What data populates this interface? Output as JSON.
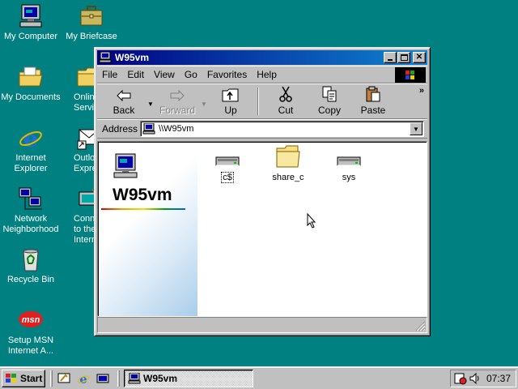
{
  "desktop": {
    "icons": [
      {
        "label": "My Computer",
        "icon": "my-computer-icon"
      },
      {
        "label": "My Briefcase",
        "icon": "briefcase-icon"
      },
      {
        "label": "My Documents",
        "icon": "my-documents-icon"
      },
      {
        "label": "Online Services",
        "icon": "online-services-folder-icon"
      },
      {
        "label": "Internet Explorer",
        "icon": "internet-explorer-icon"
      },
      {
        "label": "Outlook Express",
        "icon": "outlook-express-icon"
      },
      {
        "label": "Network Neighborhood",
        "icon": "network-neighborhood-icon"
      },
      {
        "label": "Connect to the Internet",
        "icon": "connect-internet-icon"
      },
      {
        "label": "Recycle Bin",
        "icon": "recycle-bin-icon"
      },
      {
        "label": "Setup MSN Internet A...",
        "icon": "msn-icon"
      }
    ],
    "background_color": "#008080"
  },
  "window": {
    "title": "W95vm",
    "menu": [
      "File",
      "Edit",
      "View",
      "Go",
      "Favorites",
      "Help"
    ],
    "toolbar": {
      "back": "Back",
      "forward": "Forward",
      "up": "Up",
      "cut": "Cut",
      "copy": "Copy",
      "paste": "Paste"
    },
    "address": {
      "label": "Address",
      "value": "\\\\W95vm"
    },
    "panel_title": "W95vm",
    "items": [
      {
        "label": "c$",
        "icon": "network-drive-icon",
        "selected": true
      },
      {
        "label": "share_c",
        "icon": "shared-folder-icon",
        "selected": false
      },
      {
        "label": "sys",
        "icon": "network-drive-icon",
        "selected": false
      }
    ],
    "title_bar_colors": [
      "#000080",
      "#1084d0"
    ]
  },
  "taskbar": {
    "start_label": "Start",
    "task_button": "W95vm",
    "clock": "07:37"
  }
}
